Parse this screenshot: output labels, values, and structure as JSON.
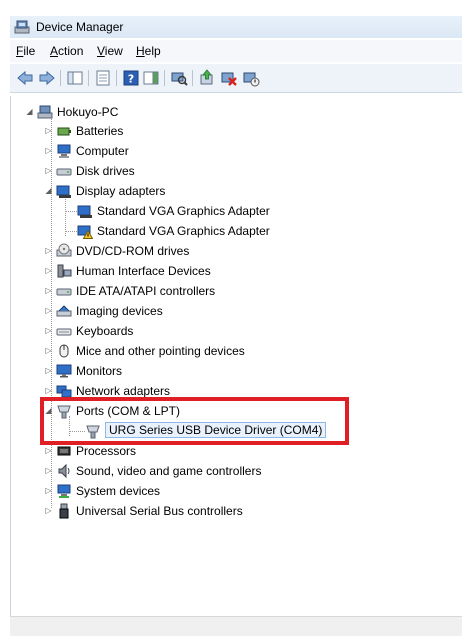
{
  "window": {
    "title": "Device Manager"
  },
  "menu": {
    "file": {
      "mnemonic": "F",
      "rest": "ile"
    },
    "action": {
      "mnemonic": "A",
      "rest": "ction"
    },
    "view": {
      "mnemonic": "V",
      "rest": "iew"
    },
    "help": {
      "mnemonic": "H",
      "rest": "elp"
    }
  },
  "toolbar": {
    "buttons": [
      "back-icon",
      "forward-icon",
      "show-hide-console-tree-icon",
      "properties-icon",
      "help-icon",
      "action-pane-icon",
      "scan-hardware-icon",
      "update-driver-icon",
      "uninstall-icon",
      "disable-device-icon"
    ]
  },
  "tree": {
    "root": {
      "label": "Hokuyo-PC"
    },
    "items": {
      "batteries": "Batteries",
      "computer": "Computer",
      "disk_drives": "Disk drives",
      "display_adapters": "Display adapters",
      "vga1": "Standard VGA Graphics Adapter",
      "vga2": "Standard VGA Graphics Adapter",
      "dvd": "DVD/CD-ROM drives",
      "hid": "Human Interface Devices",
      "ide": "IDE ATA/ATAPI controllers",
      "imaging": "Imaging devices",
      "keyboards": "Keyboards",
      "mice": "Mice and other pointing devices",
      "monitors": "Monitors",
      "network": "Network adapters",
      "ports": "Ports (COM & LPT)",
      "urg": "URG Series USB Device Driver (COM4)",
      "processors": "Processors",
      "sound": "Sound, video and game controllers",
      "system": "System devices",
      "usb": "Universal Serial Bus controllers"
    }
  },
  "colors": {
    "highlight": "#e01e25",
    "selection": "#e9f2fc"
  }
}
